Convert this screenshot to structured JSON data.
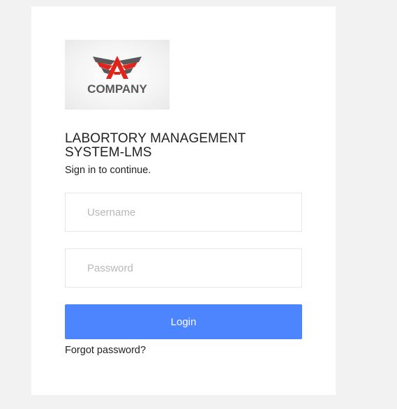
{
  "logo": {
    "icon": "winged-a-logo",
    "text": "COMPANY",
    "colors": {
      "primary": "#e2231a",
      "secondary": "#595959"
    }
  },
  "login": {
    "title": "LABORTORY MANAGEMENT SYSTEM-LMS",
    "subtitle": "Sign in to continue.",
    "username_placeholder": "Username",
    "username_value": "",
    "password_placeholder": "Password",
    "password_value": "",
    "login_label": "Login",
    "forgot_label": "Forgot password?"
  },
  "theme": {
    "accent": "#4d84ff",
    "background": "#f2f2f2",
    "card": "#ffffff"
  }
}
